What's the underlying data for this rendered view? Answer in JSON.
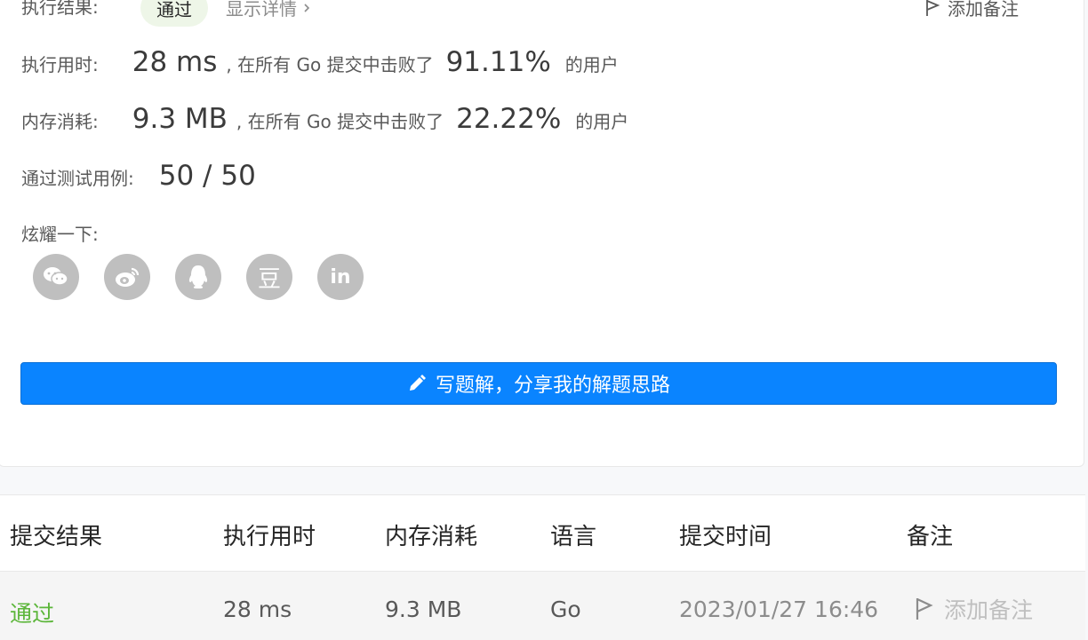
{
  "result": {
    "label": "执行结果:",
    "status": "通过",
    "details_link": "显示详情",
    "add_note": "添加备注"
  },
  "runtime": {
    "label": "执行用时:",
    "value": "28 ms",
    "text": ", 在所有 Go 提交中击败了",
    "percent": "91.11%",
    "suffix": "的用户"
  },
  "memory": {
    "label": "内存消耗:",
    "value": "9.3 MB",
    "text": ", 在所有 Go 提交中击败了",
    "percent": "22.22%",
    "suffix": "的用户"
  },
  "tests": {
    "label": "通过测试用例:",
    "value": "50 / 50"
  },
  "share": {
    "label": "炫耀一下:",
    "icons": [
      "wechat-icon",
      "weibo-icon",
      "qq-icon",
      "douban-icon",
      "linkedin-icon"
    ],
    "douban_glyph": "豆",
    "linkedin_glyph": "in"
  },
  "solution_button": {
    "label": "写题解，分享我的解题思路"
  },
  "table": {
    "headers": [
      "提交结果",
      "执行用时",
      "内存消耗",
      "语言",
      "提交时间",
      "备注"
    ],
    "rows": [
      {
        "result": "通过",
        "runtime": "28 ms",
        "memory": "9.3 MB",
        "language": "Go",
        "time": "2023/01/27 16:46",
        "note": "添加备注"
      }
    ]
  },
  "colors": {
    "accent": "#0a84ff",
    "pass_green": "#5cb63a",
    "icon_gray": "#bfbfbf"
  }
}
